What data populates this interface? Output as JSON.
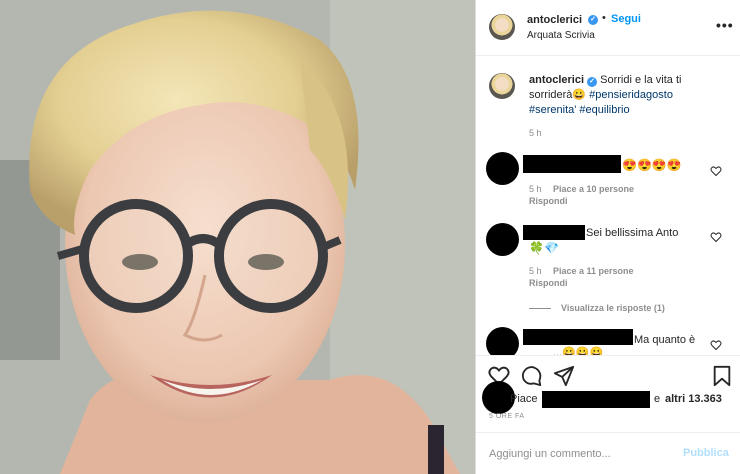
{
  "post": {
    "username": "antoclerici",
    "follow_label": "Segui",
    "separator": "•",
    "location": "Arquata Scrivia",
    "more_label": "•••",
    "verified_mark": "✓"
  },
  "caption": {
    "username": "antoclerici",
    "text": "Sorridi e la vita ti sorriderà😀",
    "hashtags": [
      "#pensieridagosto",
      "#serenita'",
      "#equilibrio"
    ],
    "time": "5 h"
  },
  "comments": [
    {
      "author": "[redacted]",
      "text": "😍😍😍😍",
      "time": "5 h",
      "likes": "Piace a 10 persone",
      "reply_label": "Rispondi"
    },
    {
      "author": "[redacted]",
      "text": "Sei bellissima Anto",
      "text2": "🍀💎",
      "time": "5 h",
      "likes": "Piace a 11 persone",
      "reply_label": "Rispondi",
      "view_replies": "Visualizza le risposte (1)"
    },
    {
      "author": "[redacted]",
      "text": "Ma quanto è",
      "text2": "...😀😀😀"
    }
  ],
  "actions": {
    "icons": [
      "heart-icon",
      "comment-icon",
      "share-icon",
      "bookmark-icon"
    ]
  },
  "likes": {
    "prefix": "Piace",
    "connector": "e",
    "others": "altri 13.363"
  },
  "time_ago": "5 ORE FA",
  "composer": {
    "placeholder": "Aggiungi un commento...",
    "publish_label": "Pubblica"
  },
  "colors": {
    "accent": "#0095f6",
    "verified": "#3897f0",
    "hashtag": "#00376b",
    "muted": "#8e8e8e",
    "publish_disabled": "#b2dffc"
  }
}
